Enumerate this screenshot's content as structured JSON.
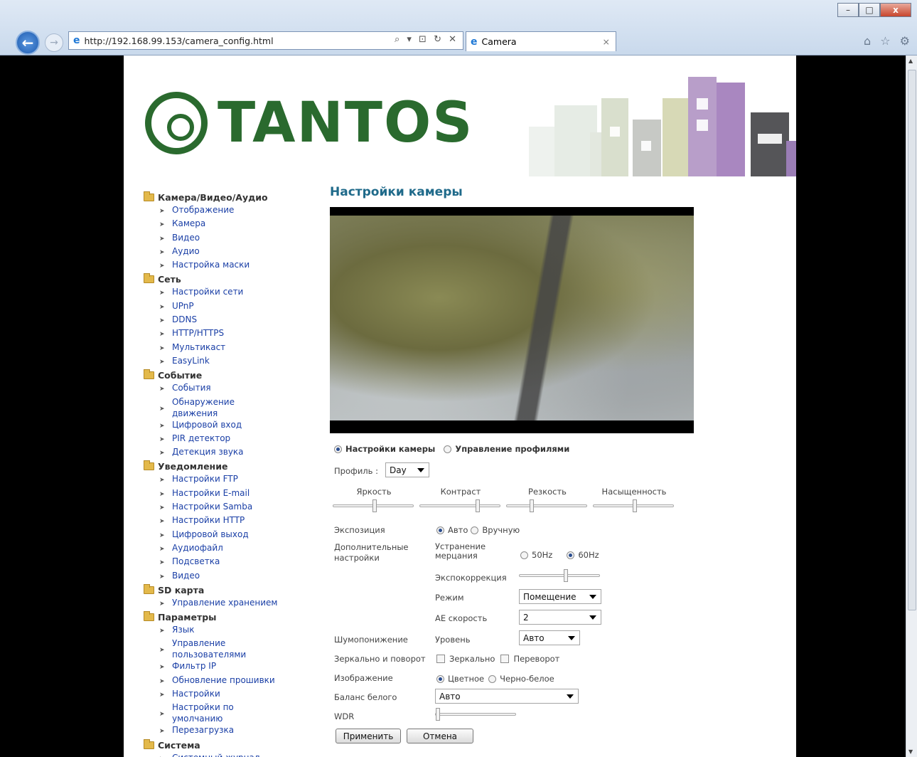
{
  "browser": {
    "url": "http://192.168.99.153/camera_config.html",
    "tab_title": "Camera",
    "minimize": "–",
    "maximize": "□",
    "close": "x",
    "back": "←",
    "forward": "→",
    "address_tools": "⌕ ▾ ⊡ ↻ ✕",
    "tab_close": "×",
    "right_icons": "⌂ ☆ ⚙"
  },
  "header": {
    "logo_text": "TANTOS"
  },
  "sidebar": {
    "groups": [
      {
        "label": "Камера/Видео/Аудио",
        "items": [
          "Отображение",
          "Камера",
          "Видео",
          "Аудио",
          "Настройка маски"
        ]
      },
      {
        "label": "Сеть",
        "items": [
          "Настройки сети",
          "UPnP",
          "DDNS",
          "HTTP/HTTPS",
          "Мультикаст",
          "EasyLink"
        ]
      },
      {
        "label": "Событие",
        "items": [
          "События",
          "Обнаружение движения",
          "Цифровой вход",
          "PIR детектор",
          "Детекция звука"
        ]
      },
      {
        "label": "Уведомление",
        "items": [
          "Настройки FTP",
          "Настройки E-mail",
          "Настройки Samba",
          "Настройки HTTP",
          "Цифровой выход",
          "Аудиофайл",
          "Подсветка",
          "Видео"
        ]
      },
      {
        "label": "SD карта",
        "items": [
          "Управление хранением"
        ]
      },
      {
        "label": "Параметры",
        "items": [
          "Язык",
          "Управление пользователями",
          "Фильтр IP",
          "Обновление прошивки",
          "Настройки",
          "Настройки по умолчанию",
          "Перезагрузка"
        ]
      },
      {
        "label": "Система",
        "items": [
          "Системный журнал"
        ]
      }
    ]
  },
  "main": {
    "title": "Настройки камеры",
    "mode_camera": "Настройки камеры",
    "mode_profiles": "Управление профилями",
    "profile_label": "Профиль :",
    "profile_value": "Day",
    "sliders": {
      "brightness": "Яркость",
      "contrast": "Контраст",
      "sharpness": "Резкость",
      "saturation": "Насыщенность"
    },
    "exposure_label": "Экспозиция",
    "exposure_auto": "Авто",
    "exposure_manual": "Вручную",
    "extra_label": "Дополнительные настройки",
    "flicker_label": "Устранение мерцания",
    "hz50": "50Hz",
    "hz60": "60Hz",
    "expcomp_label": "Экспокоррекция",
    "mode_label": "Режим",
    "mode_value": "Помещение",
    "ae_label": "AE скорость",
    "ae_value": "2",
    "noise_label": "Шумопонижение",
    "noise_level_label": "Уровень",
    "noise_value": "Авто",
    "mirror_label": "Зеркально и поворот",
    "mirror": "Зеркально",
    "flip": "Переворот",
    "image_label": "Изображение",
    "color": "Цветное",
    "bw": "Черно-белое",
    "wb_label": "Баланс белого",
    "wb_value": "Авто",
    "wdr_label": "WDR",
    "apply": "Применить",
    "cancel": "Отмена"
  }
}
